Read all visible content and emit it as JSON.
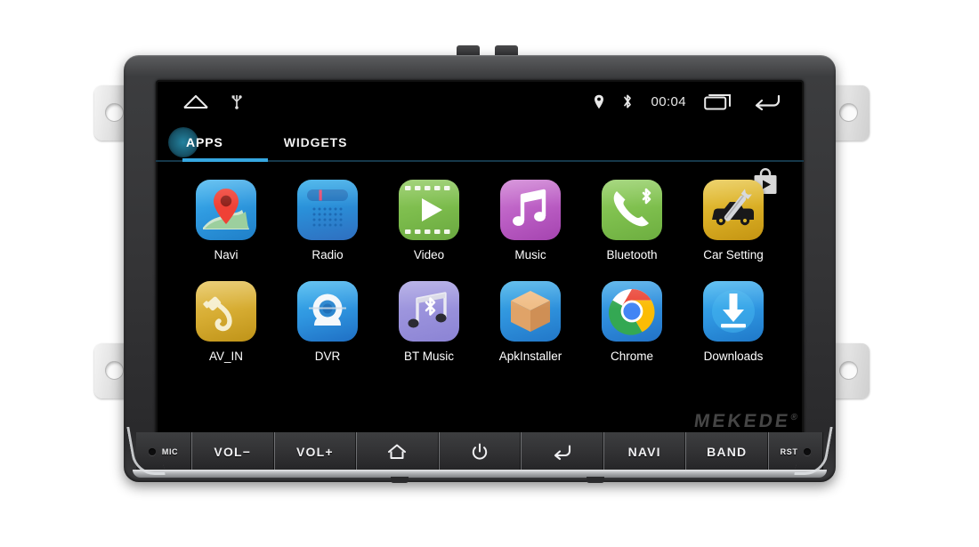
{
  "device": {
    "brand": "MEKEDE",
    "brand_mark": "®"
  },
  "statusbar": {
    "home_icon": "home-outline-icon",
    "usb_icon": "usb-icon",
    "location_icon": "location-pin-icon",
    "bluetooth_icon": "bluetooth-icon",
    "clock": "00:04",
    "recents_icon": "recents-icon",
    "back_icon": "back-arrow-icon"
  },
  "launcher": {
    "tabs": [
      {
        "label": "APPS",
        "active": true
      },
      {
        "label": "WIDGETS",
        "active": false
      }
    ],
    "playstore_icon": "play-store-bag-icon",
    "accent_color": "#36a7e0",
    "apps": [
      {
        "label": "Navi",
        "icon": "map-pin-icon",
        "class": "ic-navi"
      },
      {
        "label": "Radio",
        "icon": "radio-icon",
        "class": "ic-radio"
      },
      {
        "label": "Video",
        "icon": "film-play-icon",
        "class": "ic-video"
      },
      {
        "label": "Music",
        "icon": "music-note-icon",
        "class": "ic-music"
      },
      {
        "label": "Bluetooth",
        "icon": "phone-handset-icon",
        "class": "ic-bt"
      },
      {
        "label": "Car Setting",
        "icon": "car-wrench-icon",
        "class": "ic-car"
      },
      {
        "label": "AV_IN",
        "icon": "av-plug-icon",
        "class": "ic-av"
      },
      {
        "label": "DVR",
        "icon": "webcam-icon",
        "class": "ic-dvr"
      },
      {
        "label": "BT Music",
        "icon": "bt-music-icon",
        "class": "ic-btm"
      },
      {
        "label": "ApkInstaller",
        "icon": "package-box-icon",
        "class": "ic-apk"
      },
      {
        "label": "Chrome",
        "icon": "chrome-icon",
        "class": "ic-chrome"
      },
      {
        "label": "Downloads",
        "icon": "download-arrow-icon",
        "class": "ic-dl"
      }
    ]
  },
  "hardware_buttons": [
    {
      "label": "MIC",
      "type": "mic"
    },
    {
      "label": "VOL−",
      "type": "text"
    },
    {
      "label": "VOL+",
      "type": "text"
    },
    {
      "label": "",
      "type": "home"
    },
    {
      "label": "",
      "type": "power"
    },
    {
      "label": "",
      "type": "back"
    },
    {
      "label": "NAVI",
      "type": "text"
    },
    {
      "label": "BAND",
      "type": "text"
    },
    {
      "label": "RST",
      "type": "reset"
    }
  ]
}
